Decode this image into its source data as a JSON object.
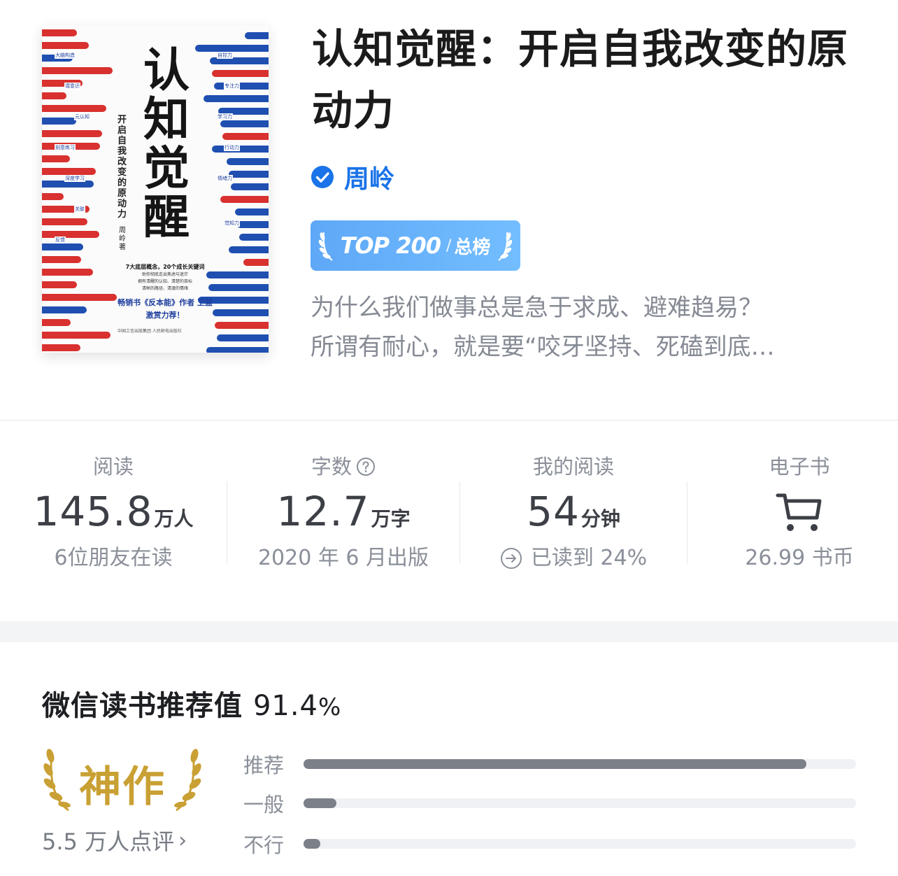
{
  "book": {
    "title": "认知觉醒：开启自我改变的原动力",
    "author": "周岭",
    "rank_badge": {
      "top_text": "TOP 200",
      "label": "总榜"
    },
    "intro_lines": [
      "为什么我们做事总是急于求成、避难趋易？",
      "所谓有耐心，就是要“咬牙坚持、死磕到底…"
    ]
  },
  "cover": {
    "title_chars": [
      "认",
      "知",
      "觉",
      "醒"
    ],
    "subtitle": "开启自我改变的原动力",
    "author": "周岭 著",
    "left_tags": [
      "大脑构造",
      "潜意识",
      "元认知",
      "刻意练习",
      "深度学习",
      "关联",
      "反馈"
    ],
    "right_tags": [
      "自控力",
      "专注力",
      "学习力",
      "行动力",
      "情绪力",
      "觉知力"
    ],
    "blurb_line1": "7大底层概念，20个成长关键词",
    "blurb_line2": "助你彻底走出焦虑与迷茫",
    "blurb_line3": "拥有清醒的认知、清楚的目标",
    "blurb_line4": "清晰的路径、清澈的情绪",
    "blurb_recommend": "畅销书《反本能》作者 卫蓝",
    "blurb_recommend2": "激赏力荐！",
    "publisher": "中国工信出版集团  人民邮电出版社",
    "colors": {
      "red": "#d8312f",
      "blue": "#1f4fb0"
    }
  },
  "stats": {
    "reading": {
      "label": "阅读",
      "value": "145.8",
      "unit": "万人",
      "sub": "6位朋友在读"
    },
    "words": {
      "label": "字数",
      "value": "12.7",
      "unit": "万字",
      "sub": "2020 年 6 月出版",
      "icon": "help-icon"
    },
    "my_reading": {
      "label": "我的阅读",
      "value": "54",
      "unit": "分钟",
      "sub": "已读到 24%",
      "icon": "arrow-circle-icon",
      "progress_percent": 24
    },
    "ebook": {
      "label": "电子书",
      "price": "26.99 书币",
      "icon": "cart-icon"
    }
  },
  "recommendation": {
    "title": "微信读书推荐值",
    "value": "91.4",
    "percent_sign": "%",
    "grade": "神作",
    "review_count": "5.5 万人点评",
    "bars": [
      {
        "label": "推荐",
        "fraction": 0.91
      },
      {
        "label": "一般",
        "fraction": 0.06
      },
      {
        "label": "不行",
        "fraction": 0.03
      }
    ]
  },
  "colors": {
    "accent_blue": "#1a73e8",
    "badge_blue": "#66b0fa",
    "gold": "#c9a033",
    "bar_gray": "#7c8089"
  }
}
